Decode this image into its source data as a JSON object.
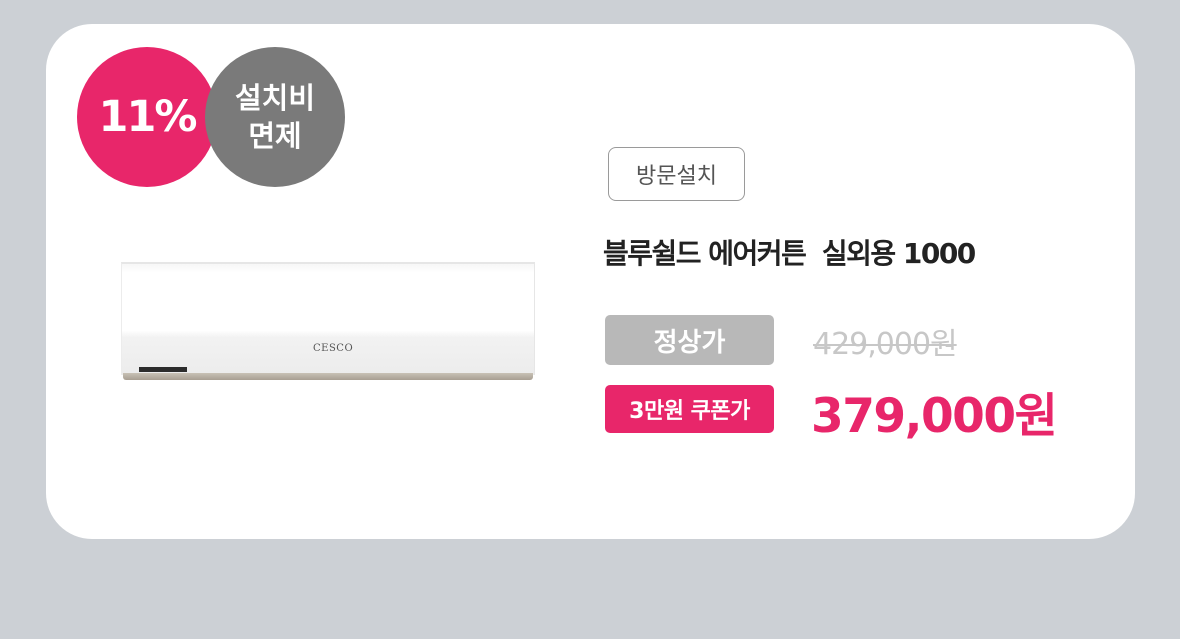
{
  "badges": {
    "discount": "11%",
    "install_line1": "설치비",
    "install_line2": "면제"
  },
  "product": {
    "image_logo": "CESCO",
    "visit_tag": "방문설치",
    "title": "블루쉴드 에어커튼  실외용 1000"
  },
  "pricing": {
    "regular_label": "정상가",
    "regular_price": "429,000원",
    "coupon_label": "3만원 쿠폰가",
    "coupon_price": "379,000원"
  },
  "colors": {
    "accent": "#e8266a",
    "badge_gray": "#7a7a7a",
    "label_gray": "#b8b8b8",
    "background": "#ccd0d5",
    "card": "#ffffff"
  }
}
